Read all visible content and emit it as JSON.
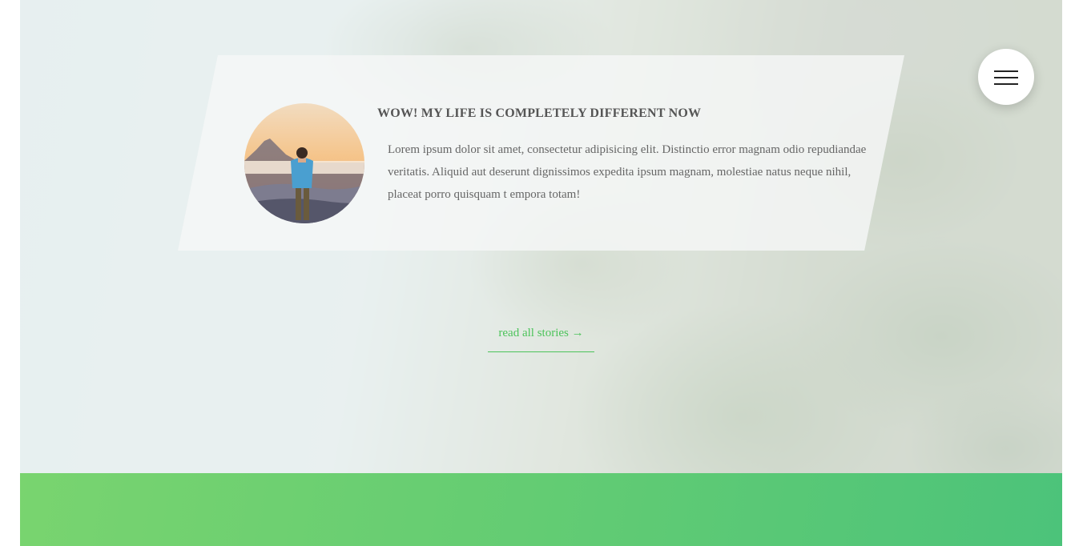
{
  "testimonial": {
    "title": "WOW! MY LIFE IS COMPLETELY DIFFERENT NOW",
    "text": "Lorem ipsum dolor sit amet, consectetur adipisicing elit. Distinctio error magnam odio repudiandae veritatis. Aliquid aut deserunt dignissimos expedita ipsum magnam, molestiae natus neque nihil, placeat porro quisquam t empora totam!"
  },
  "stories_link": {
    "label": "read all stories →"
  },
  "colors": {
    "accent_green": "#4cc35a",
    "band_gradient_start": "#79d46f",
    "band_gradient_end": "#4cc37a"
  },
  "icons": {
    "menu": "hamburger-menu-icon",
    "avatar": "person-on-mountain-photo"
  }
}
